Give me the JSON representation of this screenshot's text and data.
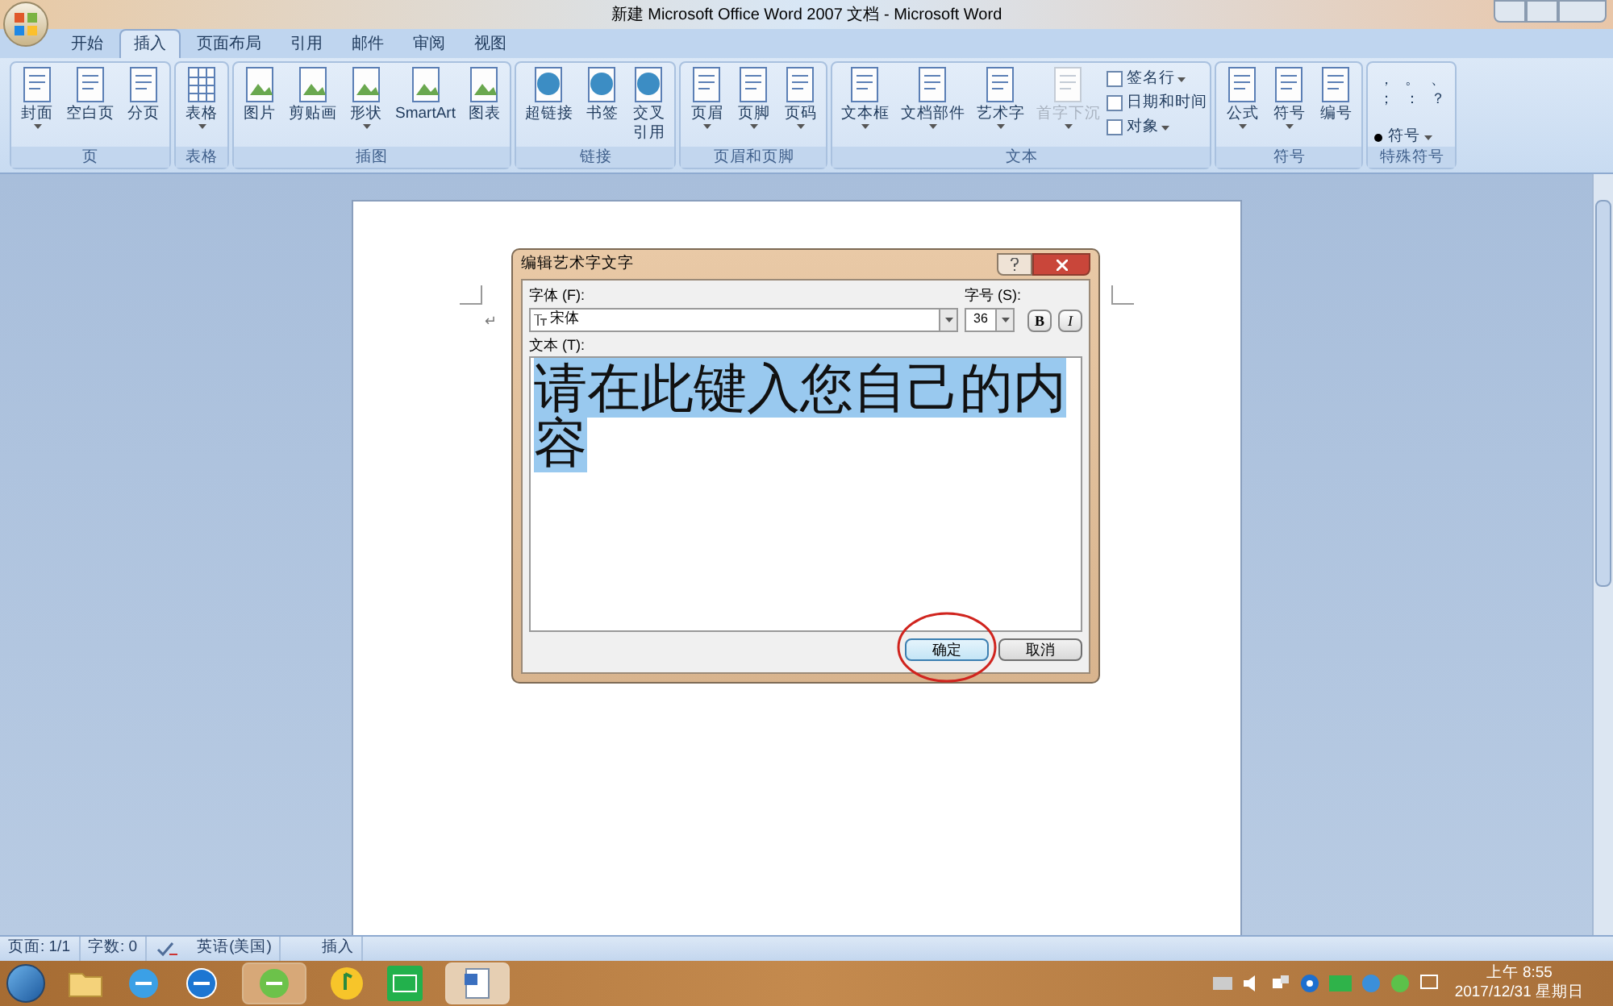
{
  "window": {
    "title": "新建 Microsoft Office Word 2007 文档 - Microsoft Word"
  },
  "tabs": [
    {
      "label": "开始",
      "selected": false
    },
    {
      "label": "插入",
      "selected": true
    },
    {
      "label": "页面布局",
      "selected": false
    },
    {
      "label": "引用",
      "selected": false
    },
    {
      "label": "邮件",
      "selected": false
    },
    {
      "label": "审阅",
      "selected": false
    },
    {
      "label": "视图",
      "selected": false
    }
  ],
  "ribbon": {
    "groups": [
      {
        "label": "页",
        "commands": [
          {
            "label": "封面",
            "dropdown": true,
            "disabled": false
          },
          {
            "label": "空白页",
            "dropdown": false,
            "disabled": false
          },
          {
            "label": "分页",
            "dropdown": false,
            "disabled": false
          }
        ]
      },
      {
        "label": "表格",
        "commands": [
          {
            "label": "表格",
            "dropdown": true,
            "disabled": false
          }
        ]
      },
      {
        "label": "插图",
        "commands": [
          {
            "label": "图片",
            "dropdown": false,
            "disabled": false
          },
          {
            "label": "剪贴画",
            "dropdown": false,
            "disabled": false
          },
          {
            "label": "形状",
            "dropdown": true,
            "disabled": false
          },
          {
            "label": "SmartArt",
            "dropdown": false,
            "disabled": false
          },
          {
            "label": "图表",
            "dropdown": false,
            "disabled": false
          }
        ]
      },
      {
        "label": "链接",
        "commands": [
          {
            "label": "超链接",
            "dropdown": false,
            "disabled": false
          },
          {
            "label": "书签",
            "dropdown": false,
            "disabled": false
          },
          {
            "label": "交叉引用",
            "dropdown": false,
            "disabled": false
          }
        ]
      },
      {
        "label": "页眉和页脚",
        "commands": [
          {
            "label": "页眉",
            "dropdown": true,
            "disabled": false
          },
          {
            "label": "页脚",
            "dropdown": true,
            "disabled": false
          },
          {
            "label": "页码",
            "dropdown": true,
            "disabled": false
          }
        ]
      },
      {
        "label": "文本",
        "commands": [
          {
            "label": "文本框",
            "dropdown": true,
            "disabled": false
          },
          {
            "label": "文档部件",
            "dropdown": true,
            "disabled": false
          },
          {
            "label": "艺术字",
            "dropdown": true,
            "disabled": false
          },
          {
            "label": "首字下沉",
            "dropdown": true,
            "disabled": true
          }
        ],
        "small_commands": [
          {
            "label": "签名行",
            "dropdown": true
          },
          {
            "label": "日期和时间",
            "dropdown": false
          },
          {
            "label": "对象",
            "dropdown": true
          }
        ]
      },
      {
        "label": "符号",
        "commands": [
          {
            "label": "公式",
            "dropdown": true,
            "disabled": false
          },
          {
            "label": "符号",
            "dropdown": true,
            "disabled": false
          },
          {
            "label": "编号",
            "dropdown": false,
            "disabled": false
          }
        ]
      },
      {
        "label": "特殊符号",
        "marks": [
          "，",
          "。",
          "、",
          "；",
          "：",
          "？"
        ],
        "small_commands": [
          {
            "label": "符号",
            "dropdown": true
          }
        ]
      }
    ]
  },
  "document": {
    "paragraph_mark": "↵"
  },
  "dialog": {
    "title": "编辑艺术字文字",
    "font_label": "字体 (F):",
    "font": "宋体",
    "size_label": "字号 (S):",
    "size": "36",
    "style_buttons": [
      {
        "label": "B",
        "pressed": false
      },
      {
        "label": "I",
        "pressed": false
      }
    ],
    "text_label": "文本 (T):",
    "text": "请在此键入您自己的内容",
    "text_selected": true,
    "buttons": [
      {
        "label": "确定",
        "default": true,
        "circled": true
      },
      {
        "label": "取消",
        "default": false,
        "circled": false
      }
    ]
  },
  "status_bar": {
    "items": [
      "页面: 1/1",
      "字数: 0",
      "英语(美国)",
      "插入"
    ]
  },
  "taskbar": {
    "time": "上午 8:55",
    "date": "2017/12/31 星期日"
  }
}
